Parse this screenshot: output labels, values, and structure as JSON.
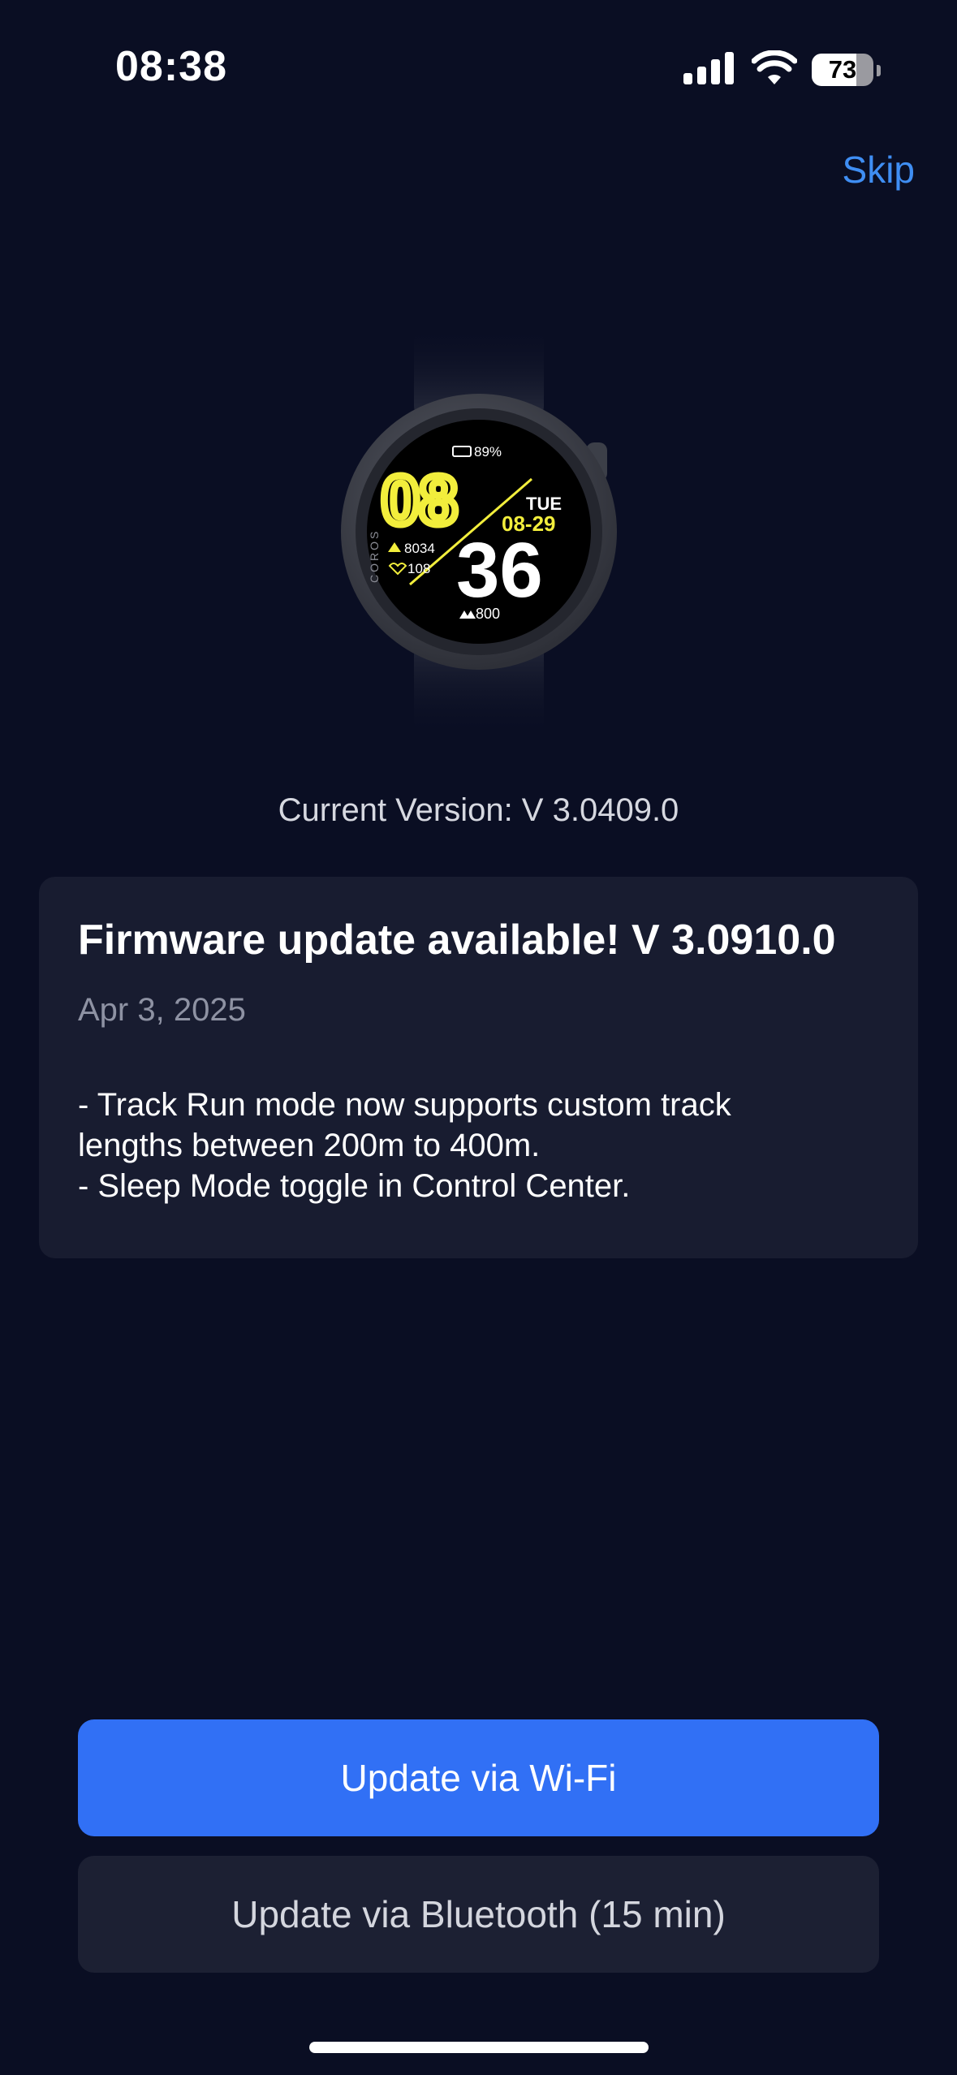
{
  "status_bar": {
    "time": "08:38",
    "battery": "73",
    "battery_level": 0.73
  },
  "header": {
    "skip_label": "Skip"
  },
  "watch": {
    "battery": "89%",
    "hour": "08",
    "minute": "36",
    "day": "TUE",
    "date": "08-29",
    "steps": "8034",
    "heart_rate": "108",
    "elevation": "800",
    "brand": "COROS"
  },
  "current_version": "Current Version: V 3.0409.0",
  "update_card": {
    "title": "Firmware update available! V 3.0910.0",
    "date": "Apr 3, 2025",
    "notes": [
      "- Track Run mode now supports custom track",
      "lengths between 200m to 400m.",
      "- Sleep Mode toggle in Control Center."
    ]
  },
  "buttons": {
    "wifi_label": "Update via Wi-Fi",
    "bluetooth_label": "Update via Bluetooth (15 min)"
  },
  "colors": {
    "background": "#0a0e23",
    "card": "#181c30",
    "accent": "#3170f5",
    "link": "#3f8ef3",
    "watch_yellow": "#f2ee3c"
  }
}
